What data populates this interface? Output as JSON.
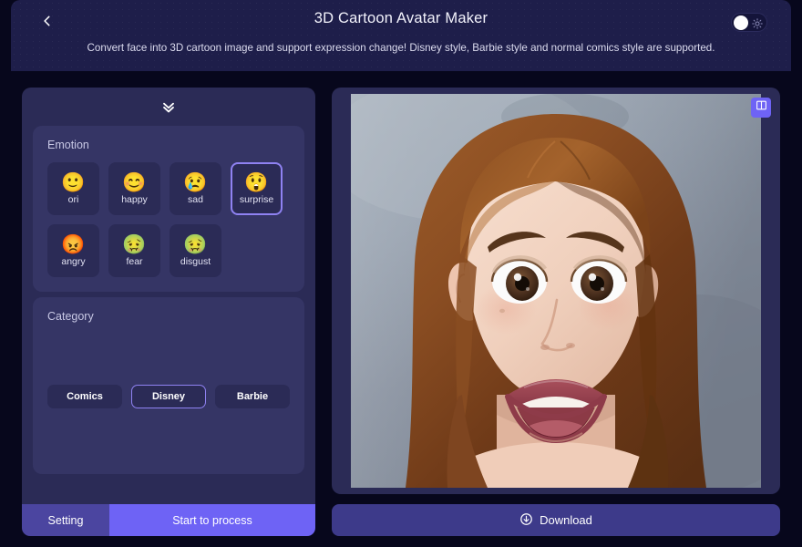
{
  "header": {
    "title": "3D Cartoon Avatar Maker",
    "subtitle": "Convert face into 3D cartoon image and support expression change! Disney style, Barbie style and normal comics style are supported.",
    "back_icon": "chevron-left-icon",
    "theme_toggle_icon": "sun-icon",
    "theme_toggle_state": "light"
  },
  "sidebar": {
    "collapse_icon": "double-chevron-down-icon",
    "emotion": {
      "title": "Emotion",
      "selected": "surprise",
      "options": [
        {
          "id": "ori",
          "label": "ori",
          "glyph": "🙂",
          "selected": false
        },
        {
          "id": "happy",
          "label": "happy",
          "glyph": "😊",
          "selected": false
        },
        {
          "id": "sad",
          "label": "sad",
          "glyph": "😢",
          "selected": false
        },
        {
          "id": "surprise",
          "label": "surprise",
          "glyph": "😲",
          "selected": true
        },
        {
          "id": "angry",
          "label": "angry",
          "glyph": "😡",
          "selected": false
        },
        {
          "id": "fear",
          "label": "fear",
          "glyph": "🤢",
          "selected": false
        },
        {
          "id": "disgust",
          "label": "disgust",
          "glyph": "🤢",
          "selected": false
        }
      ]
    },
    "category": {
      "title": "Category",
      "selected": "Disney",
      "options": [
        {
          "label": "Comics",
          "selected": false
        },
        {
          "label": "Disney",
          "selected": true
        },
        {
          "label": "Barbie",
          "selected": false
        }
      ]
    },
    "actions": {
      "setting_label": "Setting",
      "process_label": "Start to process"
    }
  },
  "preview": {
    "compare_icon": "split-compare-icon",
    "download_label": "Download",
    "download_icon": "download-circle-icon",
    "image_description": "3D cartoon portrait of a young woman with long auburn hair, surprised open-mouth expression, on a grey-blue background"
  },
  "colors": {
    "page_background": "#07071c",
    "header_background": "#1e1e4a",
    "panel_background": "#2b2b56",
    "card_background": "#353565",
    "accent": "#6e63f5",
    "accent_border": "#8f82f2",
    "setting_button": "#4b45a0",
    "download_button": "#3d3a8a"
  }
}
